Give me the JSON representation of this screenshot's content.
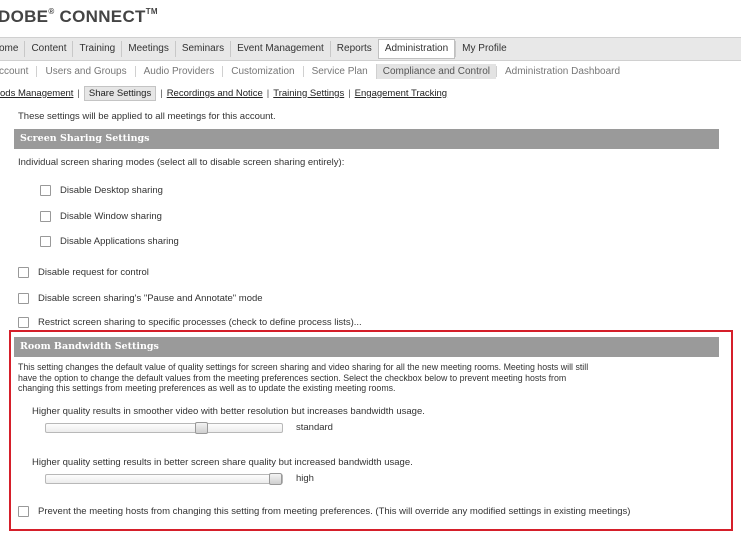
{
  "brand": {
    "name": "DOBE",
    "name_rest": " CONNECT",
    "tm": "TM",
    "mark": "®"
  },
  "nav1": {
    "items": [
      {
        "label": "ome"
      },
      {
        "label": "Content"
      },
      {
        "label": "Training"
      },
      {
        "label": "Meetings"
      },
      {
        "label": "Seminars"
      },
      {
        "label": "Event Management"
      },
      {
        "label": "Reports"
      },
      {
        "label": "Administration",
        "active": true
      },
      {
        "label": "My Profile"
      }
    ]
  },
  "nav2": {
    "items": [
      {
        "label": "ccount"
      },
      {
        "label": "Users and Groups"
      },
      {
        "label": "Audio Providers"
      },
      {
        "label": "Customization"
      },
      {
        "label": "Service Plan"
      },
      {
        "label": "Compliance and Control",
        "active": true
      },
      {
        "label": "Administration Dashboard"
      }
    ]
  },
  "nav3": {
    "links": [
      {
        "label": "ods Management"
      },
      {
        "label": "Share Settings",
        "active": true
      },
      {
        "label": "Recordings and Notice"
      },
      {
        "label": "Training Settings"
      },
      {
        "label": "Engagement Tracking"
      }
    ],
    "separator": "|"
  },
  "intro": "These settings will be applied to all meetings for this account.",
  "screen_sharing": {
    "heading": "Screen Sharing Settings",
    "modes_label": "Individual screen sharing modes (select all to disable screen sharing entirely):",
    "modes": [
      {
        "label": "Disable Desktop sharing",
        "checked": false
      },
      {
        "label": "Disable Window sharing",
        "checked": false
      },
      {
        "label": "Disable Applications sharing",
        "checked": false
      }
    ],
    "options": [
      {
        "label": "Disable request for control",
        "checked": false
      },
      {
        "label": "Disable screen sharing's \"Pause and Annotate\" mode",
        "checked": false
      },
      {
        "label": "Restrict screen sharing to specific processes (check to define process lists)...",
        "checked": false
      }
    ]
  },
  "bandwidth": {
    "heading": "Room Bandwidth Settings",
    "description_lines": [
      "This setting changes the default value of quality settings for screen sharing and video sharing for all the new meeting rooms. Meeting hosts will still",
      "have the option to change the default values from the meeting preferences section. Select the checkbox below to prevent meeting hosts from",
      "changing this settings from meeting preferences as well as to update the existing meeting rooms."
    ],
    "video": {
      "label": "Higher quality results in smoother video with better resolution but increases bandwidth usage.",
      "value_label": "standard",
      "level": 0.67
    },
    "screen": {
      "label": "Higher quality setting results in better screen share quality but increased bandwidth usage.",
      "value_label": "high",
      "level": 1.0
    },
    "prevent": {
      "label": "Prevent the meeting hosts from changing this setting from meeting preferences. (This will override any modified settings in existing meetings)",
      "checked": false
    }
  },
  "colors": {
    "highlight": "#d51f2a",
    "section_header": "#9a9a9a"
  }
}
